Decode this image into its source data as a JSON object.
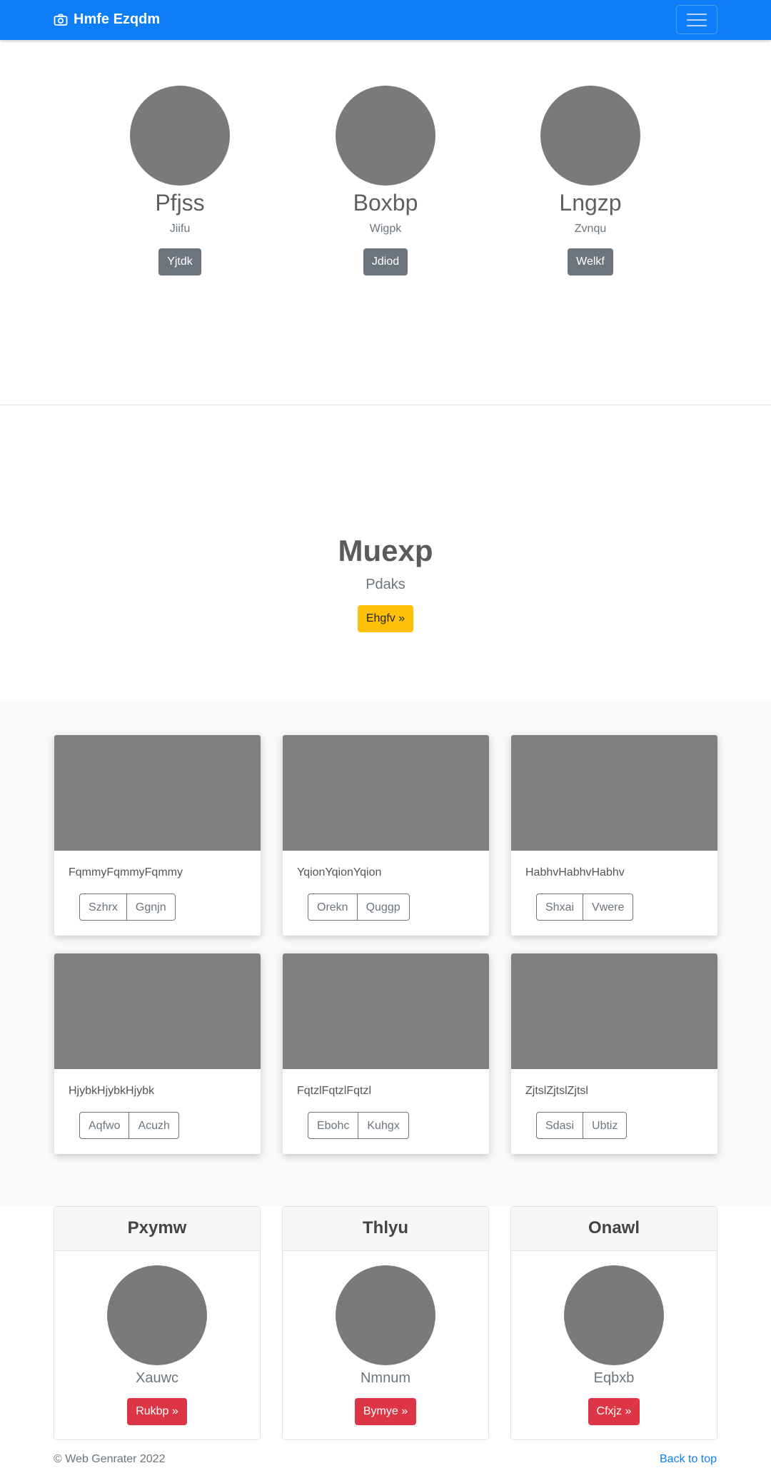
{
  "navbar": {
    "brand": "Hmfe Ezqdm",
    "brand_icon": "camera-icon",
    "toggler_icon": "hamburger-menu-icon",
    "background": "#0d7ef8"
  },
  "team": [
    {
      "name": "Pfjss",
      "role": "Jiifu",
      "button": "Yjtdk"
    },
    {
      "name": "Boxbp",
      "role": "Wigpk",
      "button": "Jdiod"
    },
    {
      "name": "Lngzp",
      "role": "Zvnqu",
      "button": "Welkf"
    }
  ],
  "hero": {
    "title": "Muexp",
    "subtitle": "Pdaks",
    "button": "Ehgfv »"
  },
  "album": [
    {
      "text": "FqmmyFqmmyFqmmy",
      "buttons": [
        "Szhrx",
        "Ggnjn"
      ]
    },
    {
      "text": "YqionYqionYqion",
      "buttons": [
        "Orekn",
        "Quggp"
      ]
    },
    {
      "text": "HabhvHabhvHabhv",
      "buttons": [
        "Shxai",
        "Vwere"
      ]
    },
    {
      "text": "HjybkHjybkHjybk",
      "buttons": [
        "Aqfwo",
        "Acuzh"
      ]
    },
    {
      "text": "FqtzlFqtzlFqtzl",
      "buttons": [
        "Ebohc",
        "Kuhgx"
      ]
    },
    {
      "text": "ZjtslZjtslZjtsl",
      "buttons": [
        "Sdasi",
        "Ubtiz"
      ]
    }
  ],
  "profiles": [
    {
      "header": "Pxymw",
      "name": "Xauwc",
      "button": "Rukbp »"
    },
    {
      "header": "Thlyu",
      "name": "Nmnum",
      "button": "Bymye »"
    },
    {
      "header": "Onawl",
      "name": "Eqbxb",
      "button": "Cfxjz »"
    }
  ],
  "footer": {
    "copyright": "© Web Genrater 2022",
    "back_to_top": "Back to top"
  }
}
